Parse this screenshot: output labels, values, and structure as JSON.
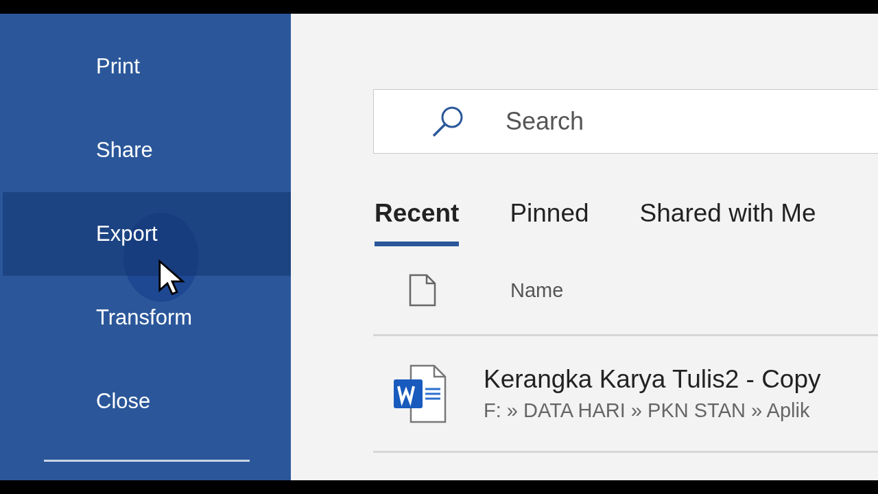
{
  "sidebar": {
    "items": [
      {
        "label": "Print",
        "selected": false
      },
      {
        "label": "Share",
        "selected": false
      },
      {
        "label": "Export",
        "selected": true
      },
      {
        "label": "Transform",
        "selected": false
      },
      {
        "label": "Close",
        "selected": false
      }
    ]
  },
  "search": {
    "placeholder": "Search"
  },
  "tabs": [
    {
      "label": "Recent",
      "selected": true
    },
    {
      "label": "Pinned",
      "selected": false
    },
    {
      "label": "Shared with Me",
      "selected": false
    }
  ],
  "table": {
    "columns": [
      "Name"
    ],
    "rows": [
      {
        "kind": "word",
        "name": "Kerangka Karya Tulis2 - Copy",
        "path": "F: » DATA HARI » PKN STAN » Aplik"
      }
    ]
  }
}
